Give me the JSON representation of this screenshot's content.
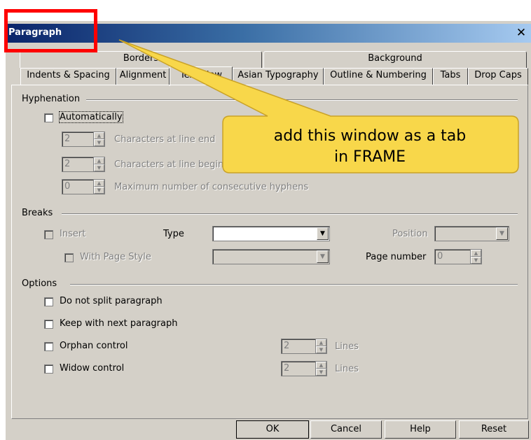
{
  "window": {
    "title": "Paragraph",
    "close_glyph": "✕"
  },
  "tabs_row1": [
    {
      "label": "Borders"
    },
    {
      "label": "Background"
    }
  ],
  "tabs_row2": [
    {
      "label": "Indents & Spacing"
    },
    {
      "label": "Alignment"
    },
    {
      "label": "Text Flow"
    },
    {
      "label": "Asian Typography"
    },
    {
      "label": "Outline & Numbering"
    },
    {
      "label": "Tabs"
    },
    {
      "label": "Drop Caps"
    }
  ],
  "hyphenation": {
    "heading": "Hyphenation",
    "automatically": "Automatically",
    "chars_line_end": {
      "value": "2",
      "label": "Characters at line end"
    },
    "chars_line_begin": {
      "value": "2",
      "label": "Characters at line begin"
    },
    "max_hyphens": {
      "value": "0",
      "label": "Maximum number of consecutive hyphens"
    }
  },
  "breaks": {
    "heading": "Breaks",
    "insert": "Insert",
    "type_label": "Type",
    "position_label": "Position",
    "with_page_style": "With Page Style",
    "page_number_label": "Page number",
    "page_number_value": "0"
  },
  "options": {
    "heading": "Options",
    "do_not_split": "Do not split paragraph",
    "keep_with_next": "Keep with next paragraph",
    "orphan_control": "Orphan control",
    "orphan_lines": "2",
    "widow_control": "Widow control",
    "widow_lines": "2",
    "lines_label": "Lines"
  },
  "buttons": {
    "ok": "OK",
    "cancel": "Cancel",
    "help": "Help",
    "reset": "Reset"
  },
  "annotation": {
    "callout_line1": "add this window as a tab",
    "callout_line2": "in FRAME",
    "callout_color": "#f8d74a",
    "box_color": "#ff0000"
  }
}
